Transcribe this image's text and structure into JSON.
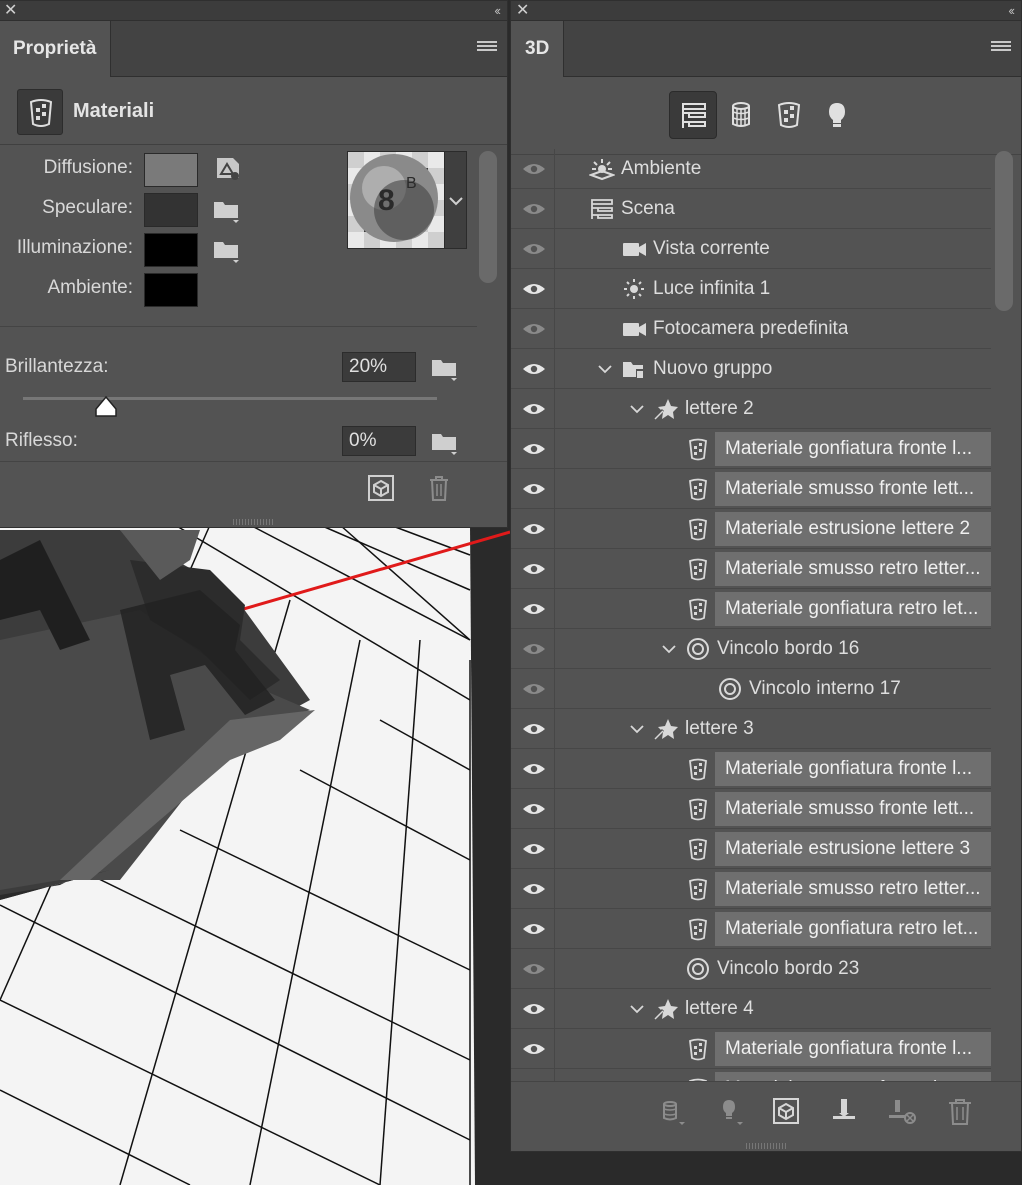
{
  "properties_panel": {
    "tab_label": "Proprietà",
    "section_title": "Materiali",
    "rows": [
      {
        "label": "Diffusione:",
        "color": "#7a7a7a"
      },
      {
        "label": "Speculare:",
        "color": "#333333"
      },
      {
        "label": "Illuminazione:",
        "color": "#000000"
      },
      {
        "label": "Ambiente:",
        "color": "#000000"
      }
    ],
    "brillantezza": {
      "label": "Brillantezza:",
      "value": "20%",
      "slider_fraction": 0.2
    },
    "riflesso": {
      "label": "Riflesso:",
      "value": "0%"
    }
  },
  "panel_3d": {
    "tab_label": "3D",
    "toolbar_icons": [
      "scene-filter-icon",
      "mesh-filter-icon",
      "material-filter-icon",
      "light-filter-icon"
    ],
    "tree": [
      {
        "level": 0,
        "label": "Ambiente",
        "icon": "environment-icon",
        "eye": "dim"
      },
      {
        "level": 0,
        "label": "Scena",
        "icon": "scene-icon",
        "eye": "dim"
      },
      {
        "level": 1,
        "label": "Vista corrente",
        "icon": "camera-icon",
        "eye": "dim"
      },
      {
        "level": 1,
        "label": "Luce infinita 1",
        "icon": "light-icon",
        "eye": "on"
      },
      {
        "level": 1,
        "label": "Fotocamera predefinita",
        "icon": "camera-icon",
        "eye": "dim"
      },
      {
        "level": 1,
        "label": "Nuovo gruppo",
        "icon": "group-icon",
        "eye": "on",
        "expanded": true
      },
      {
        "level": 2,
        "label": "lettere 2",
        "icon": "mesh-icon",
        "eye": "on",
        "expanded": true
      },
      {
        "level": 3,
        "label": "Materiale gonfiatura fronte l...",
        "icon": "material-icon",
        "eye": "on",
        "material": true
      },
      {
        "level": 3,
        "label": "Materiale smusso fronte lett...",
        "icon": "material-icon",
        "eye": "on",
        "material": true
      },
      {
        "level": 3,
        "label": "Materiale estrusione lettere 2",
        "icon": "material-icon",
        "eye": "on",
        "material": true
      },
      {
        "level": 3,
        "label": "Materiale smusso retro letter...",
        "icon": "material-icon",
        "eye": "on",
        "material": true
      },
      {
        "level": 3,
        "label": "Materiale gonfiatura retro let...",
        "icon": "material-icon",
        "eye": "on",
        "material": true
      },
      {
        "level": 3,
        "label": "Vincolo bordo 16",
        "icon": "constraint-icon",
        "eye": "dim",
        "expanded": true
      },
      {
        "level": 4,
        "label": "Vincolo interno 17",
        "icon": "constraint-icon",
        "eye": "dim"
      },
      {
        "level": 2,
        "label": "lettere 3",
        "icon": "mesh-icon",
        "eye": "on",
        "expanded": true
      },
      {
        "level": 3,
        "label": "Materiale gonfiatura fronte l...",
        "icon": "material-icon",
        "eye": "on",
        "material": true
      },
      {
        "level": 3,
        "label": "Materiale smusso fronte lett...",
        "icon": "material-icon",
        "eye": "on",
        "material": true
      },
      {
        "level": 3,
        "label": "Materiale estrusione lettere 3",
        "icon": "material-icon",
        "eye": "on",
        "material": true
      },
      {
        "level": 3,
        "label": "Materiale smusso retro letter...",
        "icon": "material-icon",
        "eye": "on",
        "material": true
      },
      {
        "level": 3,
        "label": "Materiale gonfiatura retro let...",
        "icon": "material-icon",
        "eye": "on",
        "material": true
      },
      {
        "level": 3,
        "label": "Vincolo bordo 23",
        "icon": "constraint-icon",
        "eye": "dim"
      },
      {
        "level": 2,
        "label": "lettere 4",
        "icon": "mesh-icon",
        "eye": "on",
        "expanded": true
      },
      {
        "level": 3,
        "label": "Materiale gonfiatura fronte l...",
        "icon": "material-icon",
        "eye": "on",
        "material": true
      },
      {
        "level": 3,
        "label": "Materiale smusso fronte lett...",
        "icon": "material-icon",
        "eye": "on",
        "material": true
      }
    ],
    "footer_icons": [
      "new-mesh-icon",
      "new-light-icon",
      "render-icon",
      "drop-to-floor-icon",
      "delete-constraint-icon",
      "trash-icon"
    ]
  }
}
